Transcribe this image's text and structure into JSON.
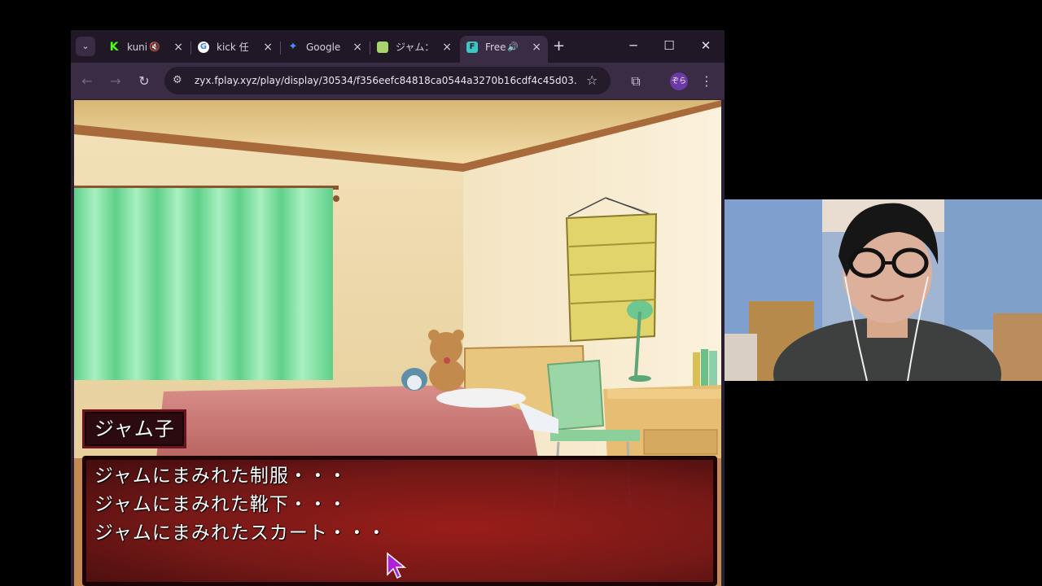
{
  "browser": {
    "tabs": [
      {
        "title": "kuni",
        "favicon": "kick-icon",
        "favicon_color": "#53fc18",
        "extra": "muted-icon"
      },
      {
        "title": "kick 任",
        "favicon": "google-icon",
        "favicon_color": "#ffffff"
      },
      {
        "title": "Google",
        "favicon": "gemini-icon",
        "favicon_color": "#4a8cff"
      },
      {
        "title": "ジャム：",
        "favicon": "image-icon",
        "favicon_color": "#a8d36a"
      },
      {
        "title": "Free",
        "favicon": "f-icon",
        "favicon_color": "#3cc6c6",
        "active": true,
        "extra": "audio-icon"
      }
    ],
    "url": "zyx.fplay.xyz/play/display/30534/f356eefc84818ca0544a3270b16cdf4c45d03...",
    "profile_label": "ぞら",
    "accent": "#3a2c44"
  },
  "game": {
    "speaker": "ジャム子",
    "lines": [
      "ジャムにまみれた制服・・・",
      "ジャムにまみれた靴下・・・",
      "ジャムにまみれたスカート・・・"
    ],
    "box_color": "#8c1418"
  },
  "webcam": {
    "icon": "streamer-webcam"
  }
}
